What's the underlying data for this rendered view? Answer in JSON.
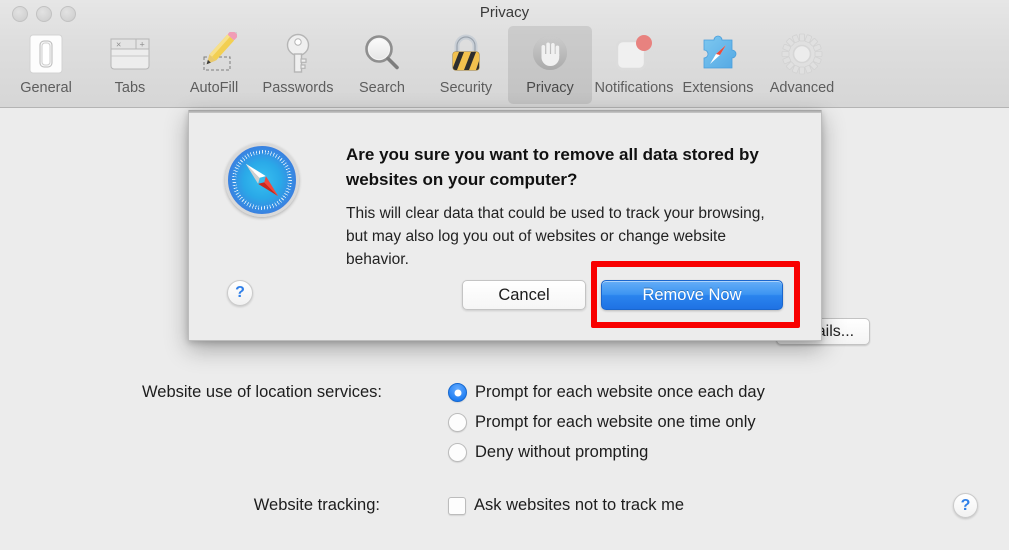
{
  "window": {
    "title": "Privacy",
    "traffic_lights": [
      "close",
      "minimize",
      "zoom"
    ]
  },
  "toolbar": {
    "items": [
      {
        "label": "General",
        "icon": "general-icon",
        "selected": false
      },
      {
        "label": "Tabs",
        "icon": "tabs-icon",
        "selected": false
      },
      {
        "label": "AutoFill",
        "icon": "autofill-icon",
        "selected": false
      },
      {
        "label": "Passwords",
        "icon": "passwords-icon",
        "selected": false
      },
      {
        "label": "Search",
        "icon": "search-icon",
        "selected": false
      },
      {
        "label": "Security",
        "icon": "security-icon",
        "selected": false
      },
      {
        "label": "Privacy",
        "icon": "privacy-hand-icon",
        "selected": true
      },
      {
        "label": "Notifications",
        "icon": "notifications-icon",
        "selected": false
      },
      {
        "label": "Extensions",
        "icon": "extensions-icon",
        "selected": false
      },
      {
        "label": "Advanced",
        "icon": "advanced-gear-icon",
        "selected": false
      }
    ]
  },
  "dialog": {
    "icon": "safari-compass-icon",
    "title": "Are you sure you want to remove all data stored by websites on your computer?",
    "message": "This will clear data that could be used to track your browsing, but may also log you out of websites or change website behavior.",
    "help_label": "?",
    "cancel_label": "Cancel",
    "confirm_label": "Remove Now",
    "highlight_color": "#f80000",
    "default_button_color": "#2a84ee"
  },
  "main": {
    "details_button_label": "Details...",
    "location": {
      "label": "Website use of location services:",
      "options": [
        {
          "label": "Prompt for each website once each day",
          "selected": true
        },
        {
          "label": "Prompt for each website one time only",
          "selected": false
        },
        {
          "label": "Deny without prompting",
          "selected": false
        }
      ]
    },
    "tracking": {
      "label": "Website tracking:",
      "checkbox_label": "Ask websites not to track me",
      "checked": false
    },
    "help_label": "?"
  }
}
